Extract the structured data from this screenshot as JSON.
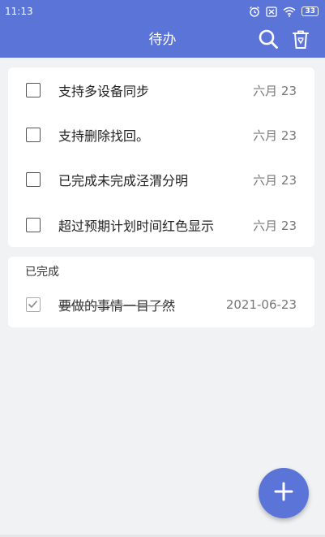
{
  "status_bar": {
    "time": "11:13",
    "icons": [
      "alarm-icon",
      "muted-icon",
      "wifi-icon"
    ],
    "battery": "33"
  },
  "app_bar": {
    "title": "待办",
    "actions": [
      "search-icon",
      "trash-icon"
    ]
  },
  "todo": {
    "items": [
      {
        "title": "支持多设备同步",
        "date": "六月 23",
        "checked": false
      },
      {
        "title": "支持删除找回。",
        "date": "六月 23",
        "checked": false
      },
      {
        "title": "已完成未完成泾渭分明",
        "date": "六月 23",
        "checked": false
      },
      {
        "title": "超过预期计划时间红色显示",
        "date": "六月 23",
        "checked": false
      }
    ]
  },
  "done": {
    "label": "已完成",
    "items": [
      {
        "title": "要做的事情一目了然",
        "date": "2021-06-23",
        "checked": true
      }
    ]
  },
  "fab": {
    "icon": "plus-icon"
  },
  "colors": {
    "accent": "#5b74d8",
    "background": "#f1f2f4",
    "card": "#ffffff"
  }
}
